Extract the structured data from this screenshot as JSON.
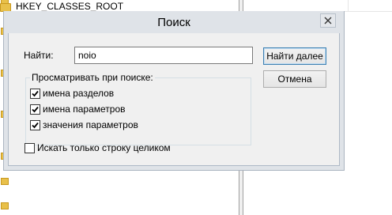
{
  "background": {
    "tree_root_label": "HKEY_CLASSES_ROOT"
  },
  "dialog": {
    "title": "Поиск",
    "find_label": "Найти:",
    "find_value": "noio",
    "find_next_label": "Найти далее",
    "cancel_label": "Отмена",
    "look_at_legend": "Просматривать при поиске:",
    "options": [
      {
        "label": "имена разделов",
        "checked": true
      },
      {
        "label": "имена параметров",
        "checked": true
      },
      {
        "label": "значения параметров",
        "checked": true
      }
    ],
    "match_whole": {
      "label": "Искать только строку целиком",
      "checked": false
    }
  },
  "colors": {
    "accent_border": "#3c7fb1",
    "window_frame": "#dfe3e8",
    "dialog_bg": "#f0f0f0"
  }
}
